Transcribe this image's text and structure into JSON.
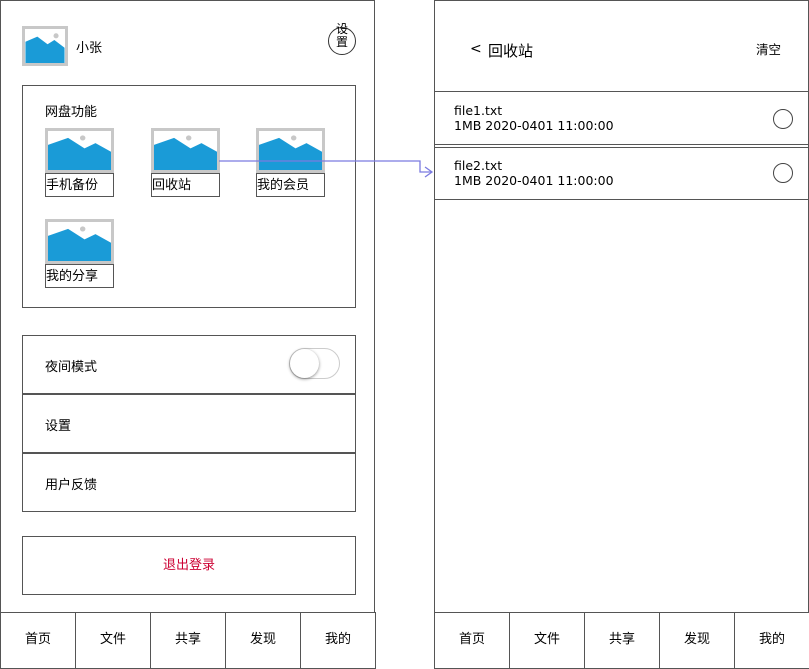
{
  "profile": {
    "username": "小张",
    "settings_badge_line1": "设",
    "settings_badge_line2": "置"
  },
  "features": {
    "title": "网盘功能",
    "items": [
      {
        "label": "手机备份"
      },
      {
        "label": "回收站"
      },
      {
        "label": "我的会员"
      },
      {
        "label": "我的分享"
      }
    ]
  },
  "menu": {
    "night_mode": "夜间模式",
    "night_mode_on": false,
    "settings": "设置",
    "feedback": "用户反馈"
  },
  "logout": {
    "label": "退出登录",
    "color": "#cc0033"
  },
  "bottom_nav": [
    "首页",
    "文件",
    "共享",
    "发现",
    "我的"
  ],
  "recycle": {
    "back_glyph": "<",
    "title": "回收站",
    "clear": "清空",
    "files": [
      {
        "name": "file1.txt",
        "meta": "1MB 2020-0401 11:00:00"
      },
      {
        "name": "file2.txt",
        "meta": "1MB 2020-0401 11:00:00"
      }
    ]
  },
  "colors": {
    "image_blue": "#1a9bd7",
    "arrow": "#7b7be0",
    "border": "#555555"
  }
}
